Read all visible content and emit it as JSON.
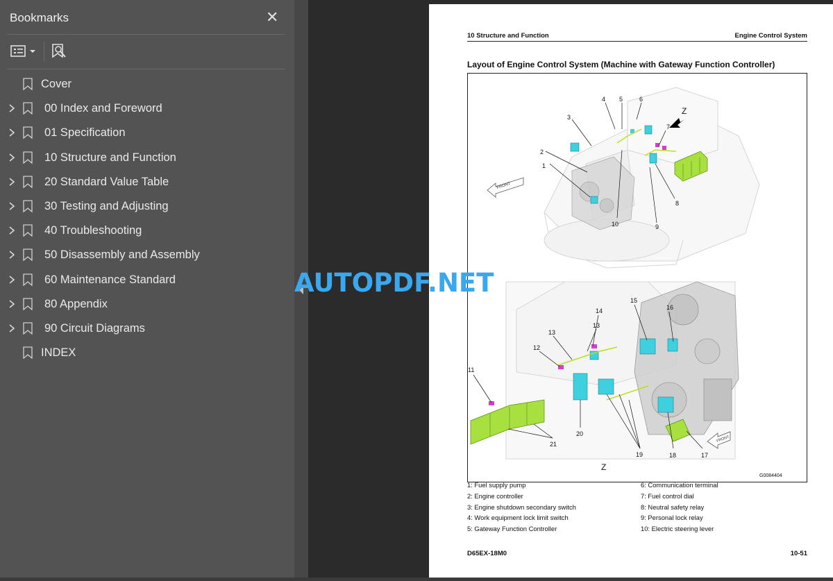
{
  "sidebar": {
    "title": "Bookmarks",
    "close_glyph": "✕",
    "toolbar": {
      "options_icon": "options-list-icon",
      "find_icon": "find-bookmark-icon"
    },
    "items": [
      {
        "label": "Cover",
        "expandable": false
      },
      {
        "label": "00 Index and Foreword",
        "expandable": true
      },
      {
        "label": "01 Specification",
        "expandable": true
      },
      {
        "label": "10 Structure and Function",
        "expandable": true
      },
      {
        "label": "20 Standard Value Table",
        "expandable": true
      },
      {
        "label": "30 Testing and Adjusting",
        "expandable": true
      },
      {
        "label": "40 Troubleshooting",
        "expandable": true
      },
      {
        "label": "50 Disassembly and Assembly",
        "expandable": true
      },
      {
        "label": "60 Maintenance Standard",
        "expandable": true
      },
      {
        "label": "80 Appendix",
        "expandable": true
      },
      {
        "label": "90 Circuit Diagrams",
        "expandable": true
      },
      {
        "label": "INDEX",
        "expandable": false
      }
    ]
  },
  "watermark": "AUTOPDF.NET",
  "page": {
    "header_left": "10 Structure and Function",
    "header_right": "Engine Control System",
    "heading": "Layout of Engine Control System (Machine with Gateway Function Controller)",
    "figure": {
      "callouts_top": [
        "1",
        "2",
        "3",
        "4",
        "5",
        "6",
        "7",
        "8",
        "9",
        "10"
      ],
      "callouts_bottom": [
        "11",
        "12",
        "13",
        "13",
        "14",
        "15",
        "16",
        "17",
        "18",
        "19",
        "20",
        "21"
      ],
      "view_label": "Z",
      "view_label_bottom": "Z",
      "front_label": "FRONT",
      "figure_code": "G0084404"
    },
    "legend_left": [
      "1: Fuel supply pump",
      "2: Engine controller",
      "3: Engine shutdown secondary switch",
      "4: Work equipment lock limit switch",
      "5: Gateway Function Controller"
    ],
    "legend_right": [
      "6: Communication terminal",
      "7: Fuel control dial",
      "8: Neutral safety relay",
      "9: Personal lock relay",
      "10: Electric steering lever"
    ],
    "footer_left": "D65EX-18M0",
    "footer_right": "10-51"
  },
  "colors": {
    "sidebar_bg": "#535353",
    "viewer_bg": "#2b2b2b",
    "watermark": "#3aa8f0",
    "component_cyan": "#3fd0e0",
    "component_magenta": "#d040d0",
    "battery_green": "#a8e040",
    "wire_green": "#b8e020"
  }
}
